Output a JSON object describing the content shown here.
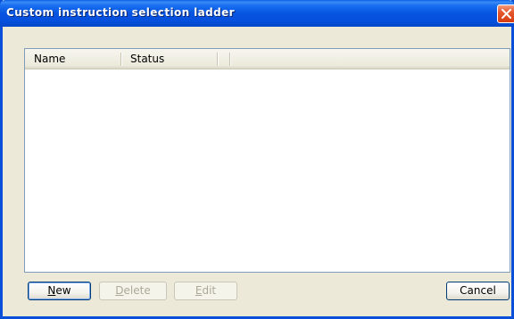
{
  "window": {
    "title": "Custom instruction selection ladder"
  },
  "listview": {
    "columns": [
      "Name",
      "Status"
    ],
    "rows": []
  },
  "buttons": {
    "new": {
      "mnemonic": "N",
      "rest": "ew"
    },
    "delete": {
      "mnemonic": "D",
      "rest": "elete"
    },
    "edit": {
      "mnemonic": "E",
      "rest": "dit"
    },
    "cancel": {
      "label": "Cancel"
    }
  },
  "colors": {
    "title_bar": "#0654e0",
    "close_button": "#e5572e",
    "window_bg": "#ece9d8"
  }
}
